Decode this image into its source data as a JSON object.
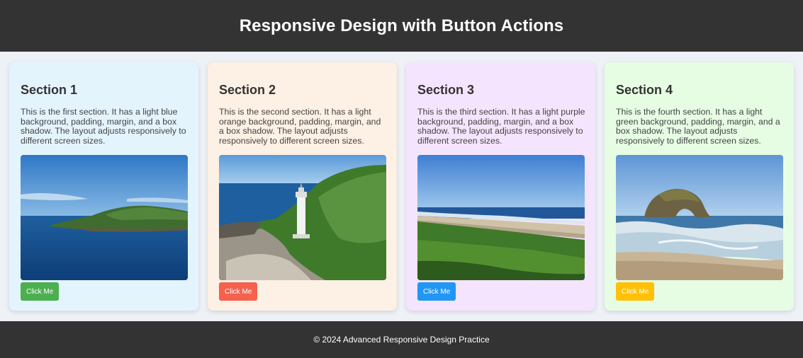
{
  "header": {
    "title": "Responsive Design with Button Actions"
  },
  "sections": [
    {
      "title": "Section 1",
      "text": "This is the first section. It has a light blue background, padding, margin, and a box shadow. The layout adjusts responsively to different screen sizes.",
      "button_label": "Click Me",
      "background": "#e4f4fd",
      "button_color": "#4caf50",
      "image_subject": "island-sea-photo"
    },
    {
      "title": "Section 2",
      "text": "This is the second section. It has a light orange background, padding, margin, and a box shadow. The layout adjusts responsively to different screen sizes.",
      "button_label": "Click Me",
      "background": "#fdf0e4",
      "button_color": "#f4614d",
      "image_subject": "lighthouse-coast-photo"
    },
    {
      "title": "Section 3",
      "text": "This is the third section. It has a light purple background, padding, margin, and a box shadow. The layout adjusts responsively to different screen sizes.",
      "button_label": "Click Me",
      "background": "#f5e4fd",
      "button_color": "#2196f3",
      "image_subject": "beach-grass-photo"
    },
    {
      "title": "Section 4",
      "text": "This is the fourth section. It has a light green background, padding, margin, and a box shadow. The layout adjusts responsively to different screen sizes.",
      "button_label": "Click Me",
      "background": "#e6fde4",
      "button_color": "#ffc107",
      "image_subject": "sea-arch-rock-photo"
    }
  ],
  "footer": {
    "text": "© 2024 Advanced Responsive Design Practice"
  }
}
